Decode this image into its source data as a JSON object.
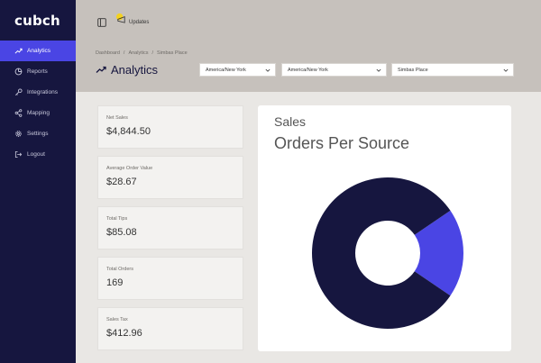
{
  "app": {
    "logo": "cubch"
  },
  "sidebar": {
    "items": [
      {
        "label": "Analytics",
        "icon": "trend-icon",
        "active": true
      },
      {
        "label": "Reports",
        "icon": "pie-icon",
        "active": false
      },
      {
        "label": "Integrations",
        "icon": "key-icon",
        "active": false
      },
      {
        "label": "Mapping",
        "icon": "share-icon",
        "active": false
      },
      {
        "label": "Settings",
        "icon": "gear-icon",
        "active": false
      },
      {
        "label": "Logout",
        "icon": "logout-icon",
        "active": false
      }
    ]
  },
  "topbar": {
    "updates_label": "Updates"
  },
  "breadcrumb": {
    "items": [
      "Dashboard",
      "Analytics",
      "Simbas Place"
    ],
    "separator": "/"
  },
  "header": {
    "title": "Analytics",
    "filters": [
      "America/New York",
      "America/New York",
      "Simbas Place"
    ]
  },
  "metrics": [
    {
      "label": "Net Sales",
      "value": "$4,844.50"
    },
    {
      "label": "Average Order Value",
      "value": "$28.67"
    },
    {
      "label": "Total Tips",
      "value": "$85.08"
    },
    {
      "label": "Total Orders",
      "value": "169"
    },
    {
      "label": "Sales Tax",
      "value": "$412.96"
    }
  ],
  "chart": {
    "subtitle": "Sales",
    "title": "Orders Per Source"
  },
  "chart_data": {
    "type": "pie",
    "donut": true,
    "slices": [
      {
        "value": 0.81,
        "color": "#16163f"
      },
      {
        "value": 0.19,
        "color": "#4a45e4"
      }
    ]
  },
  "colors": {
    "sidebar": "#16163f",
    "accent": "#4a45e4",
    "header": "#c6c1bc",
    "background": "#e9e7e4"
  }
}
